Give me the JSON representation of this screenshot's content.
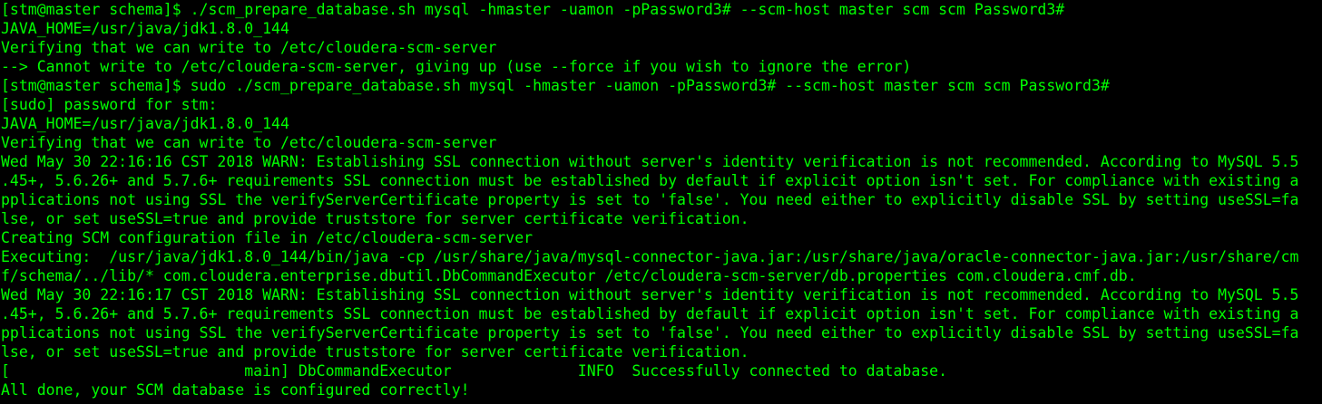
{
  "terminal": {
    "colors": {
      "background": "#000000",
      "text": "#00ff00"
    },
    "lines": [
      "[stm@master schema]$ ./scm_prepare_database.sh mysql -hmaster -uamon -pPassword3# --scm-host master scm scm Password3#",
      "JAVA_HOME=/usr/java/jdk1.8.0_144",
      "Verifying that we can write to /etc/cloudera-scm-server",
      "--> Cannot write to /etc/cloudera-scm-server, giving up (use --force if you wish to ignore the error)",
      "[stm@master schema]$ sudo ./scm_prepare_database.sh mysql -hmaster -uamon -pPassword3# --scm-host master scm scm Password3#",
      "[sudo] password for stm:",
      "JAVA_HOME=/usr/java/jdk1.8.0_144",
      "Verifying that we can write to /etc/cloudera-scm-server",
      "Wed May 30 22:16:16 CST 2018 WARN: Establishing SSL connection without server's identity verification is not recommended. According to MySQL 5.5",
      ".45+, 5.6.26+ and 5.7.6+ requirements SSL connection must be established by default if explicit option isn't set. For compliance with existing a",
      "pplications not using SSL the verifyServerCertificate property is set to 'false'. You need either to explicitly disable SSL by setting useSSL=fa",
      "lse, or set useSSL=true and provide truststore for server certificate verification.",
      "Creating SCM configuration file in /etc/cloudera-scm-server",
      "Executing:  /usr/java/jdk1.8.0_144/bin/java -cp /usr/share/java/mysql-connector-java.jar:/usr/share/java/oracle-connector-java.jar:/usr/share/cm",
      "f/schema/../lib/* com.cloudera.enterprise.dbutil.DbCommandExecutor /etc/cloudera-scm-server/db.properties com.cloudera.cmf.db.",
      "Wed May 30 22:16:17 CST 2018 WARN: Establishing SSL connection without server's identity verification is not recommended. According to MySQL 5.5",
      ".45+, 5.6.26+ and 5.7.6+ requirements SSL connection must be established by default if explicit option isn't set. For compliance with existing a",
      "pplications not using SSL the verifyServerCertificate property is set to 'false'. You need either to explicitly disable SSL by setting useSSL=fa",
      "lse, or set useSSL=true and provide truststore for server certificate verification.",
      "[                          main] DbCommandExecutor              INFO  Successfully connected to database.",
      "All done, your SCM database is configured correctly!"
    ]
  }
}
